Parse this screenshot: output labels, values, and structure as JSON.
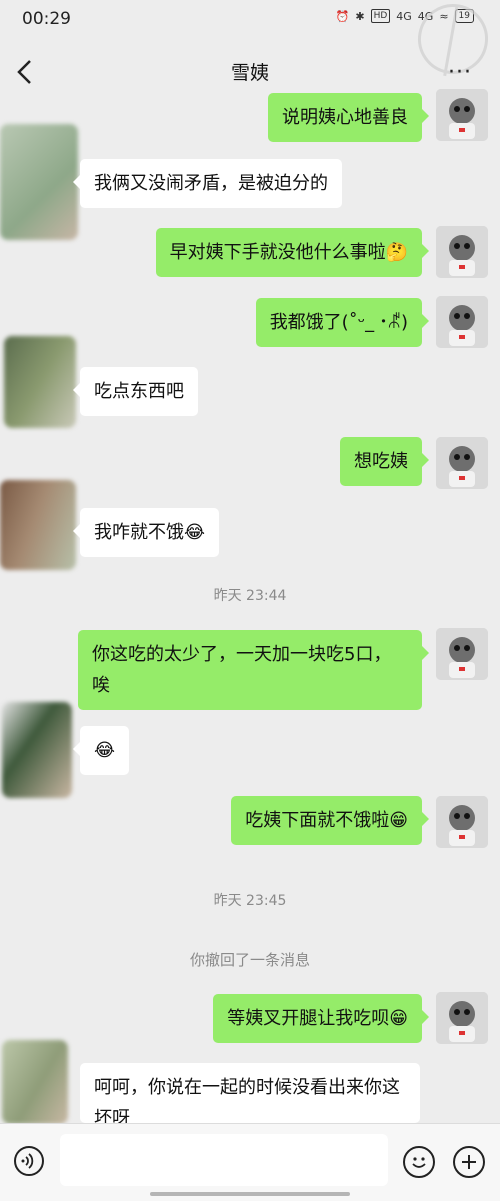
{
  "status_bar": {
    "time": "00:29",
    "network_1": "4G",
    "network_2": "4G",
    "battery": "19"
  },
  "header": {
    "title": "雪姨",
    "more_label": "···"
  },
  "messages": [
    {
      "from": "me",
      "text": "说明姨心地善良"
    },
    {
      "from": "other",
      "text": "我俩又没闹矛盾，是被迫分的"
    },
    {
      "from": "me",
      "text": "早对姨下手就没他什么事啦🤔"
    },
    {
      "from": "me",
      "text": "我都饿了(˚ᵕ_ ･ꉱ)"
    },
    {
      "from": "other",
      "text": "吃点东西吧"
    },
    {
      "from": "me",
      "text": "想吃姨"
    },
    {
      "from": "other",
      "text": "我咋就不饿😂"
    },
    {
      "from": "me",
      "text": "你这吃的太少了，一天加一块吃5口，唉"
    },
    {
      "from": "other",
      "text": "😂"
    },
    {
      "from": "me",
      "text": "吃姨下面就不饿啦😁"
    },
    {
      "from": "me",
      "text": "等姨叉开腿让我吃呗😁"
    },
    {
      "from": "other",
      "text": "呵呵，你说在一起的时候没看出来你这坏呀"
    }
  ],
  "timestamps": [
    "昨天 23:44",
    "昨天 23:45"
  ],
  "system_message": "你撤回了一条消息",
  "input": {
    "value": "",
    "placeholder": ""
  },
  "colors": {
    "self_bubble": "#95ec69",
    "other_bubble": "#ffffff",
    "background": "#ededed"
  }
}
